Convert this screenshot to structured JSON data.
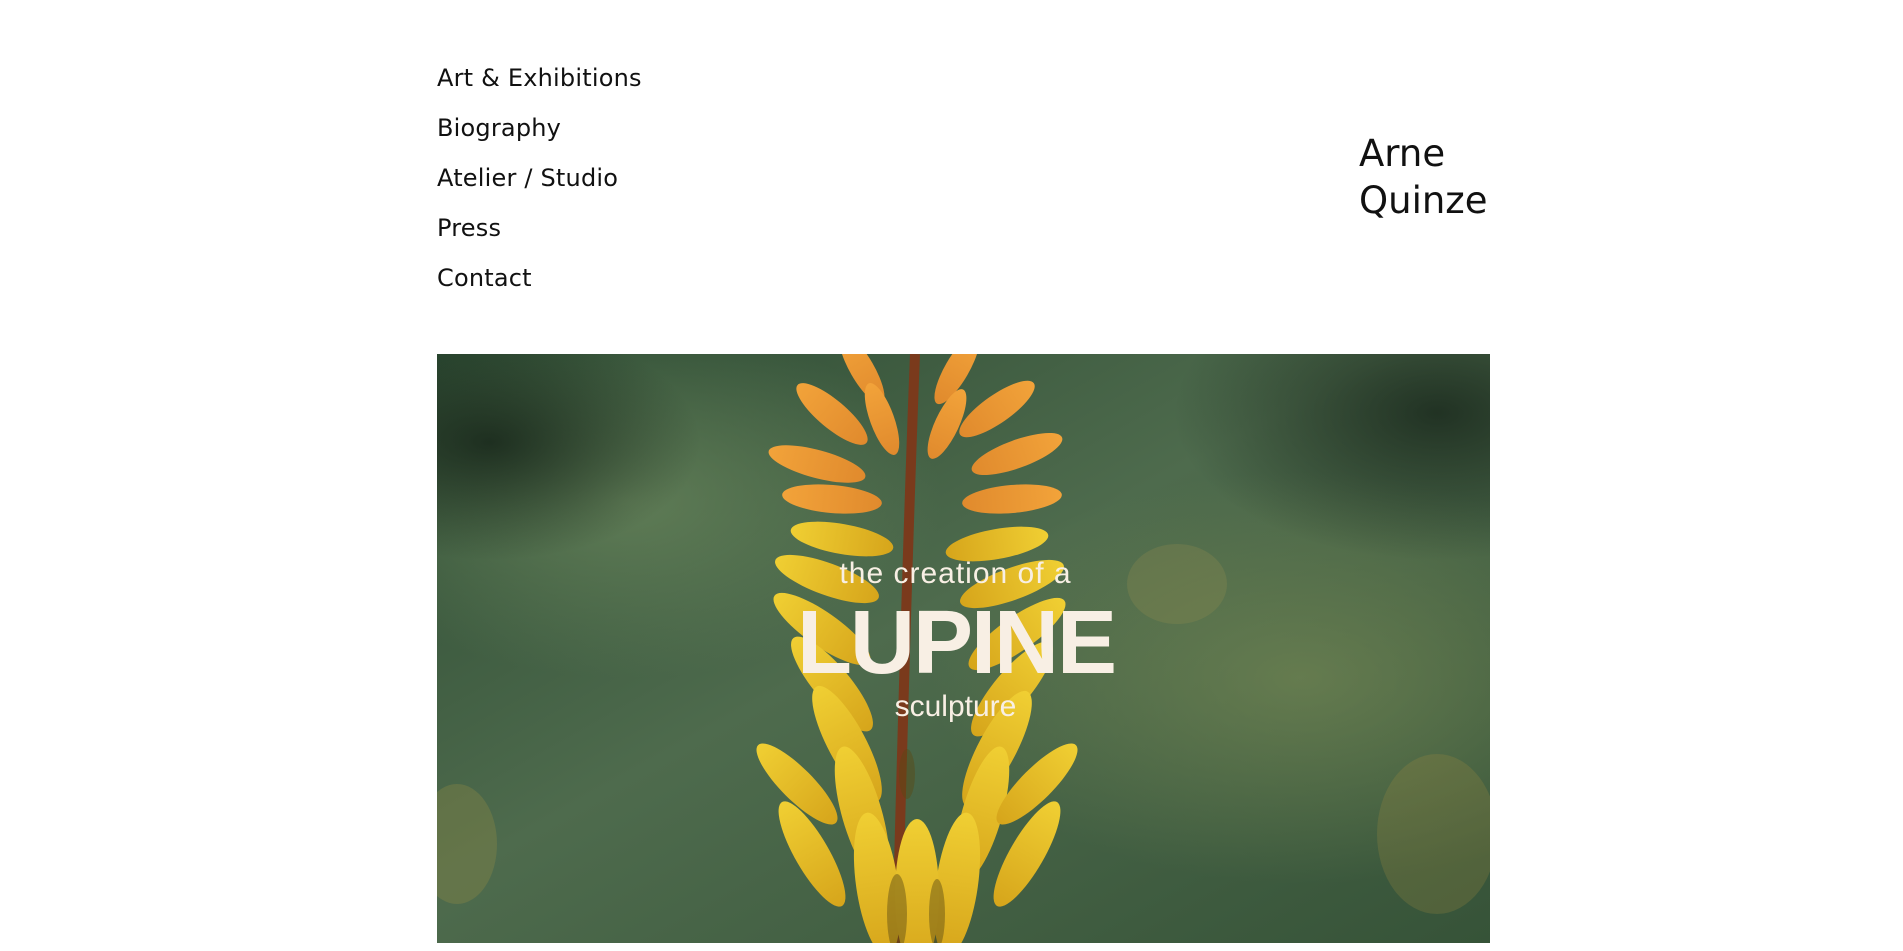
{
  "nav": {
    "items": [
      {
        "label": "Art & Exhibitions"
      },
      {
        "label": "Biography"
      },
      {
        "label": "Atelier / Studio"
      },
      {
        "label": "Press"
      },
      {
        "label": "Contact"
      }
    ]
  },
  "brand": {
    "first_name": "Arne",
    "last_name": "Quinze"
  },
  "hero": {
    "line1": "the creation of a",
    "title": "LUPINE",
    "line3": "sculpture",
    "image_subject": "yellow-orange flower spike against green blurred background"
  },
  "colors": {
    "text": "#111111",
    "background": "#ffffff",
    "hero_text": "#f8efe4",
    "foliage": "#3b5a3e",
    "petal_yellow": "#e5bf22",
    "petal_orange": "#e99a35"
  }
}
